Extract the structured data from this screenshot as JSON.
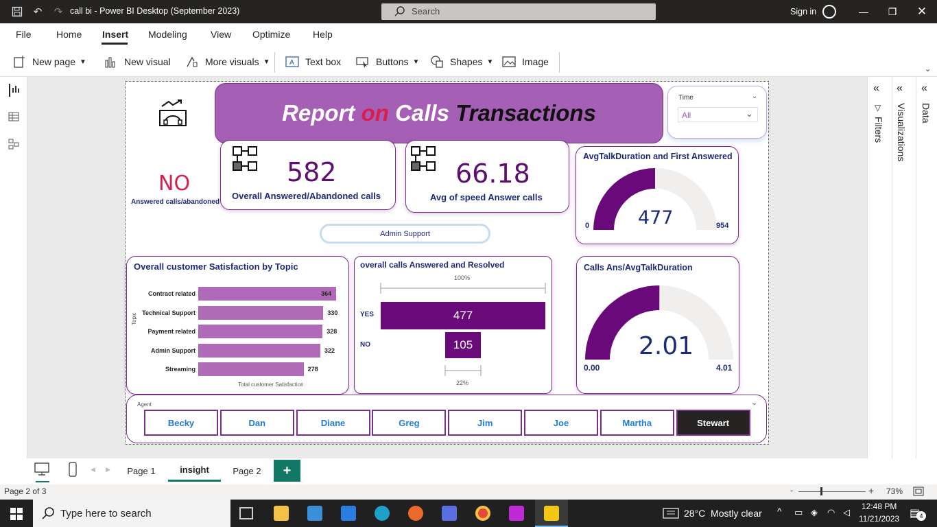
{
  "window": {
    "title": "call bi - Power BI Desktop (September 2023)",
    "search_placeholder": "Search",
    "sign_in": "Sign in"
  },
  "menu": {
    "items": [
      "File",
      "Home",
      "Insert",
      "Modeling",
      "View",
      "Optimize",
      "Help"
    ],
    "active": "Insert"
  },
  "ribbon": {
    "new_page": "New page",
    "new_visual": "New visual",
    "more_visuals": "More visuals",
    "text_box": "Text box",
    "buttons": "Buttons",
    "shapes": "Shapes",
    "image": "Image"
  },
  "right_panes": {
    "filters": "Filters",
    "visualizations": "Visualizations",
    "data": "Data"
  },
  "report": {
    "title_parts": [
      "Report",
      "on",
      "Calls",
      "Transactions"
    ],
    "slicer_time": {
      "label": "Time",
      "value": "All"
    },
    "no_card": {
      "value": "NO",
      "label": "Answered calls/abandoned"
    },
    "kpi_overall": {
      "value": "582",
      "label": "Overall Answered/Abandoned calls"
    },
    "kpi_speed": {
      "value": "66.18",
      "label": "Avg of speed Answer calls"
    },
    "topic_button": "Admin Support",
    "gauge1": {
      "title": "AvgTalkDuration and First Answered",
      "value": "477",
      "min": "0",
      "max": "954",
      "fraction": 0.5
    },
    "gauge2": {
      "title": "Calls Ans/AvgTalkDuration",
      "value": "2.01",
      "min": "0.00",
      "max": "4.01",
      "fraction": 0.501
    },
    "bar_chart": {
      "title": "Overall customer Satisfaction by Topic",
      "ylabel": "Topic",
      "xlabel": "Total customer Satisfaction"
    },
    "funnel": {
      "title": "overall calls Answered and Resolved",
      "top_pct": "100%",
      "bottom_pct": "22%",
      "labels": [
        "YES",
        "NO"
      ],
      "values": [
        "477",
        "105"
      ]
    },
    "agent_slicer": {
      "label": "Agent",
      "agents": [
        "Becky",
        "Dan",
        "Diane",
        "Greg",
        "Jim",
        "Joe",
        "Martha",
        "Stewart"
      ],
      "selected": "Stewart"
    }
  },
  "chart_data": [
    {
      "type": "bar",
      "title": "Overall customer Satisfaction by Topic",
      "categories": [
        "Contract related",
        "Technical Support",
        "Payment related",
        "Admin Support",
        "Streaming"
      ],
      "values": [
        364,
        330,
        328,
        322,
        278
      ],
      "xlabel": "Total customer Satisfaction",
      "ylabel": "Topic",
      "color": "#b06bb8"
    },
    {
      "type": "bar",
      "title": "overall calls Answered and Resolved",
      "categories": [
        "YES",
        "NO"
      ],
      "values": [
        477,
        105
      ],
      "color": "#6a0a7a"
    }
  ],
  "pages": {
    "tabs": [
      "Page 1",
      "insight",
      "Page 2"
    ],
    "active": "insight",
    "add": "+"
  },
  "status": {
    "page_info": "Page 2 of 3",
    "zoom": "73%",
    "zoom_fraction": 0.73
  },
  "taskbar": {
    "search_placeholder": "Type here to search",
    "weather": "28°C  Mostly clear",
    "time": "12:48 PM",
    "date": "11/21/2023",
    "notifications": "4"
  },
  "colors": {
    "accent": "#7b2d8b",
    "title_banner": "#a560b5",
    "dark": "#252423",
    "link": "#1e7cd6",
    "red": "#d81e4f"
  }
}
